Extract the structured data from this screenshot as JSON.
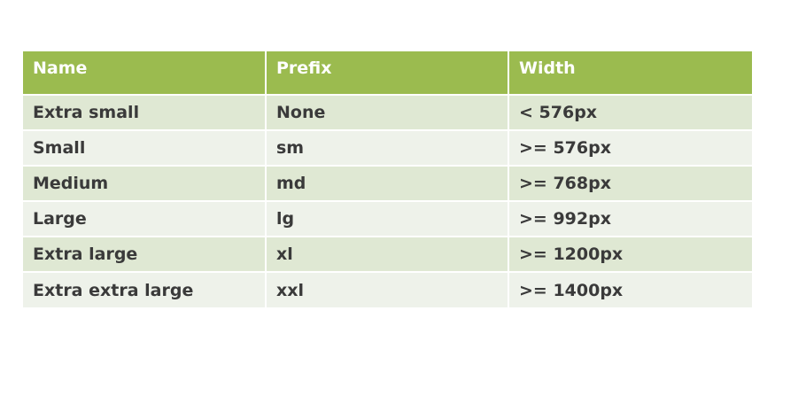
{
  "table": {
    "headers": [
      "Name",
      "Prefix",
      "Width"
    ],
    "rows": [
      [
        "Extra small",
        "None",
        "< 576px"
      ],
      [
        "Small",
        "sm",
        ">= 576px"
      ],
      [
        "Medium",
        "md",
        ">= 768px"
      ],
      [
        "Large",
        "lg",
        ">= 992px"
      ],
      [
        "Extra large",
        "xl",
        ">= 1200px"
      ],
      [
        "Extra extra large",
        "xxl",
        ">= 1400px"
      ]
    ]
  },
  "colors": {
    "header_background": "#9bbb4f",
    "header_text": "#ffffff",
    "row_odd_background": "#dfe8d3",
    "row_even_background": "#eef2ea",
    "cell_text": "#3a3a3a"
  }
}
